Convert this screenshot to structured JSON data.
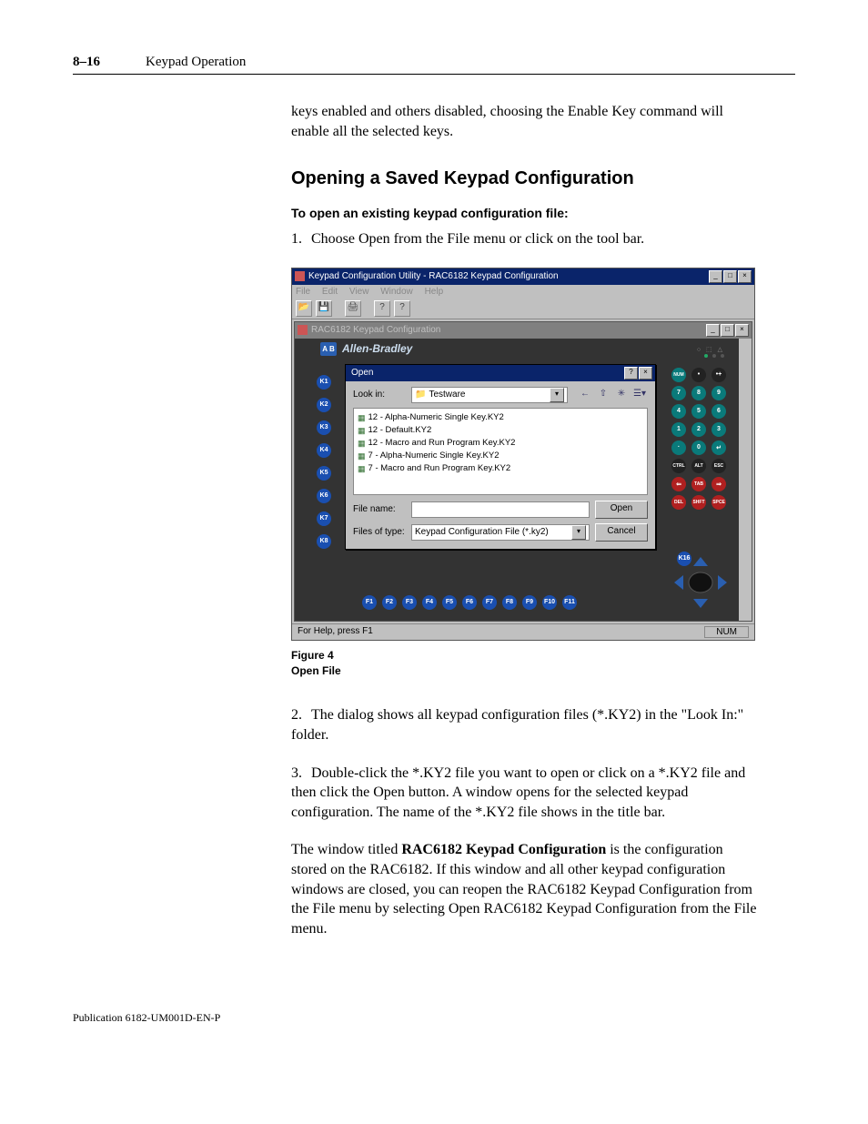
{
  "header": {
    "page_num": "8–16",
    "section": "Keypad Operation"
  },
  "intro_para": "keys enabled and others disabled, choosing the Enable Key command will enable all the selected keys.",
  "heading": "Opening a Saved Keypad Configuration",
  "subheading": "To open an existing keypad configuration file:",
  "step1": "Choose Open from the File menu or click on the tool bar.",
  "figure": {
    "num": "Figure 4",
    "title": "Open File"
  },
  "step2": "The dialog shows all keypad configuration files (*.KY2) in the \"Look In:\" folder.",
  "step3": "Double-click the *.KY2 file you want to open or click on a *.KY2 file and then click the Open button.  A window opens for the selected keypad configuration.  The name of the *.KY2 file shows in the title bar.",
  "closing_a": "The window titled ",
  "closing_bold": "RAC6182 Keypad Configuration",
  "closing_b": " is the configuration stored on the RAC6182.  If this window and all other keypad configuration windows are closed, you can reopen the RAC6182 Keypad Configuration from the File menu by selecting Open RAC6182 Keypad Configuration from the File menu.",
  "footer": "Publication 6182-UM001D-EN-P",
  "shot": {
    "app_title": "Keypad Configuration Utility - RAC6182 Keypad Configuration",
    "menus": [
      "File",
      "Edit",
      "View",
      "Window",
      "Help"
    ],
    "child_title": "RAC6182 Keypad Configuration",
    "brand": "Allen-Bradley",
    "brand_logo": "A B",
    "indicators": "○ ⬚ △",
    "left_keys": [
      "K1",
      "K2",
      "K3",
      "K4",
      "K5",
      "K6",
      "K7",
      "K8"
    ],
    "bottom_keys": [
      "F1",
      "F2",
      "F3",
      "F4",
      "F5",
      "F6",
      "F7",
      "F8",
      "F9",
      "F10",
      "F11"
    ],
    "k16": "K16",
    "right_grid": [
      "NUM",
      "•",
      "•+",
      "7",
      "8",
      "9",
      "4",
      "5",
      "6",
      "1",
      "2",
      "3",
      "·",
      "0",
      "↵",
      "CTRL",
      "ALT",
      "ESC",
      "⇐",
      "TAB",
      "⇒",
      "DEL",
      "SHFT",
      "SPCE"
    ],
    "statusbar_left": "For Help, press F1",
    "statusbar_right": "NUM",
    "dlg": {
      "title": "Open",
      "lookin_label": "Look in:",
      "lookin_value": "Testware",
      "files": [
        "12 - Alpha-Numeric Single Key.KY2",
        "12 - Default.KY2",
        "12 - Macro and Run Program Key.KY2",
        "7 - Alpha-Numeric Single Key.KY2",
        "7 - Macro and Run Program Key.KY2"
      ],
      "filename_label": "File name:",
      "filename_value": "",
      "filetype_label": "Files of type:",
      "filetype_value": "Keypad Configuration File (*.ky2)",
      "open_btn": "Open",
      "cancel_btn": "Cancel"
    }
  }
}
